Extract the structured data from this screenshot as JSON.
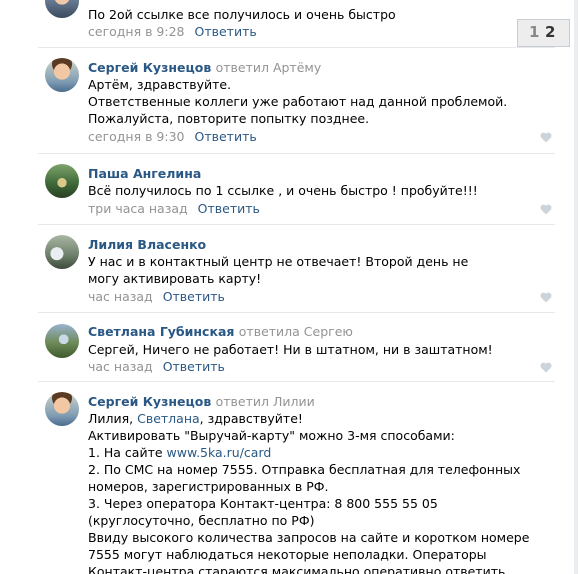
{
  "comments": [
    {
      "text": "По 2ой ссылке все получилось и очень быстро",
      "time": "сегодня в 9:28",
      "answer": "Ответить"
    },
    {
      "author": "Сергей Кузнецов",
      "reply_to": "ответил Артёму",
      "lines": [
        "Артём, здравствуйте.",
        "Ответственные коллеги уже работают над данной проблемой. Пожалуйста, повторите попытку позднее."
      ],
      "time": "сегодня в 9:30",
      "answer": "Ответить"
    },
    {
      "author": "Паша Ангелина",
      "text": "Всё получилось по 1 ссылке , и очень быстро ! пробуйте!!!",
      "time": "три часа назад",
      "answer": "Ответить"
    },
    {
      "author": "Лилия Власенко",
      "text": "У нас и в контактный центр не отвечает! Второй день не могу активировать карту!",
      "time": "час назад",
      "answer": "Ответить"
    },
    {
      "author": "Светлана Губинская",
      "reply_to": "ответила Сергею",
      "text": "Сергей, Ничего не работает! Ни в штатном, ни в заштатном!",
      "time": "час назад",
      "answer": "Ответить"
    },
    {
      "author": "Сергей Кузнецов",
      "reply_to": "ответил Лилии",
      "greeting_prefix": "Лилия, ",
      "greeting_link": "Светлана",
      "greeting_suffix": ", здравствуйте!",
      "line2": "Активировать \"Выручай-карту\" можно 3-мя способами:",
      "line3_prefix": "1. На сайте ",
      "line3_link": "www.5ka.ru/card",
      "line4": "2. По СМС на номер 7555. Отправка бесплатная для телефонных номеров, зарегистрированных в РФ.",
      "line5": "3. Через оператора Контакт-центра: 8 800 555 55 05 (круглосуточно, бесплатно по РФ)",
      "line6": "Ввиду высокого количества запросов на сайте и коротком номере 7555 могут наблюдаться некоторые неполадки. Операторы Контакт-центра стараются максимально оперативно ответить всем в условиях"
    }
  ],
  "pager": {
    "page1": "1",
    "page2": "2"
  }
}
